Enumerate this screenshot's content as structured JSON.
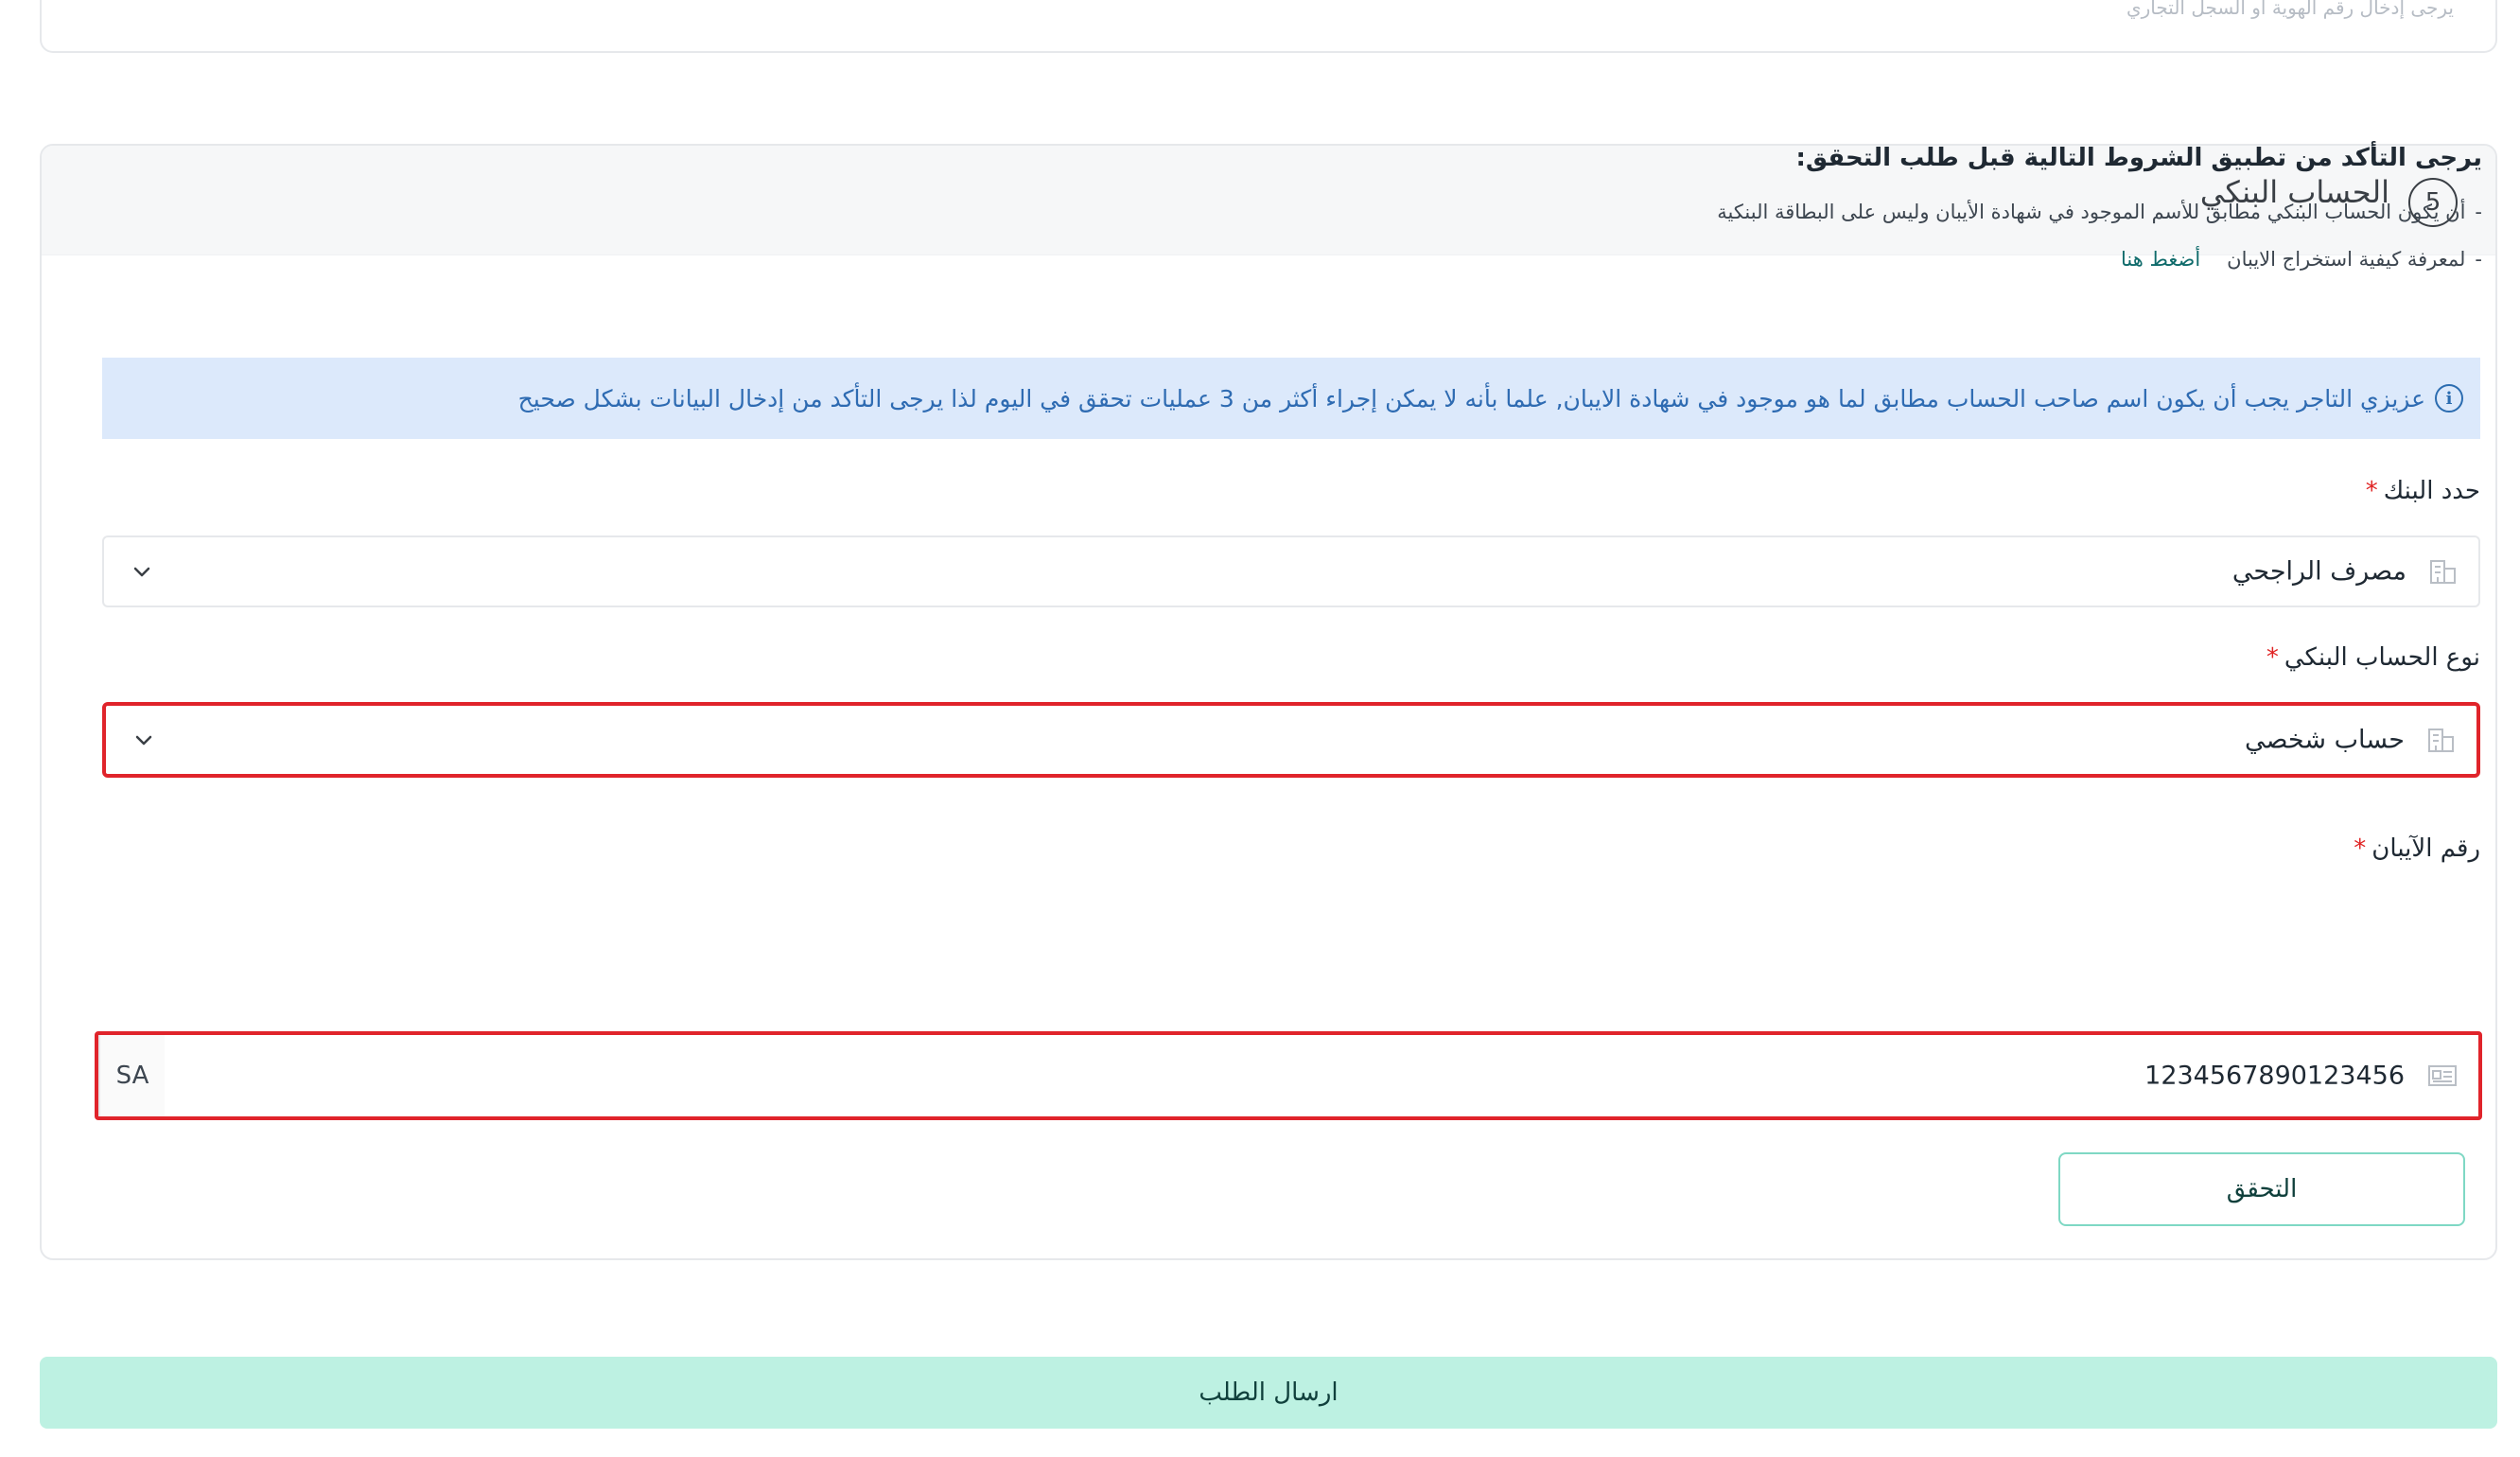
{
  "top_card": {
    "partial_text": "يرجى إدخال رقم الهوية أو السجل التجاري"
  },
  "section": {
    "step_number": "5",
    "title": "الحساب البنكي"
  },
  "conditions": {
    "title": "يرجى التأكد من تطبيق الشروط التالية قبل طلب التحقق:",
    "items": [
      {
        "dash": "-",
        "text": "أن يكون الحساب البنكي مطابق للأسم الموجود في شهادة الأيبان وليس على البطاقة البنكية"
      },
      {
        "dash": "-",
        "text": "لمعرفة كيفية استخراج الايبان",
        "link": "أضغط هنا"
      }
    ]
  },
  "alert": {
    "icon": "info-icon",
    "text": "عزيزي التاجر يجب أن يكون اسم صاحب الحساب مطابق لما هو موجود في شهادة الايبان, علما بأنه لا يمكن إجراء أكثر من 3 عمليات تحقق في اليوم لذا يرجى التأكد من إدخال البيانات بشكل صحيح"
  },
  "fields": {
    "bank": {
      "label": "حدد البنك",
      "required_mark": "*",
      "value": "مصرف الراجحي",
      "icon": "building-icon"
    },
    "account_type": {
      "label": "نوع الحساب البنكي",
      "required_mark": "*",
      "value": "حساب شخصي",
      "icon": "building-icon"
    },
    "iban": {
      "label": "رقم الآيبان",
      "required_mark": "*",
      "prefix": "SA",
      "value": "1234567890123456",
      "icon": "id-card-icon"
    }
  },
  "buttons": {
    "verify": "التحقق",
    "submit": "ارسال الطلب"
  },
  "colors": {
    "error_border": "#e0242b",
    "alert_bg": "#dce9fb",
    "submit_bg": "#bdf1e2",
    "verify_border": "#7fd8c4"
  }
}
